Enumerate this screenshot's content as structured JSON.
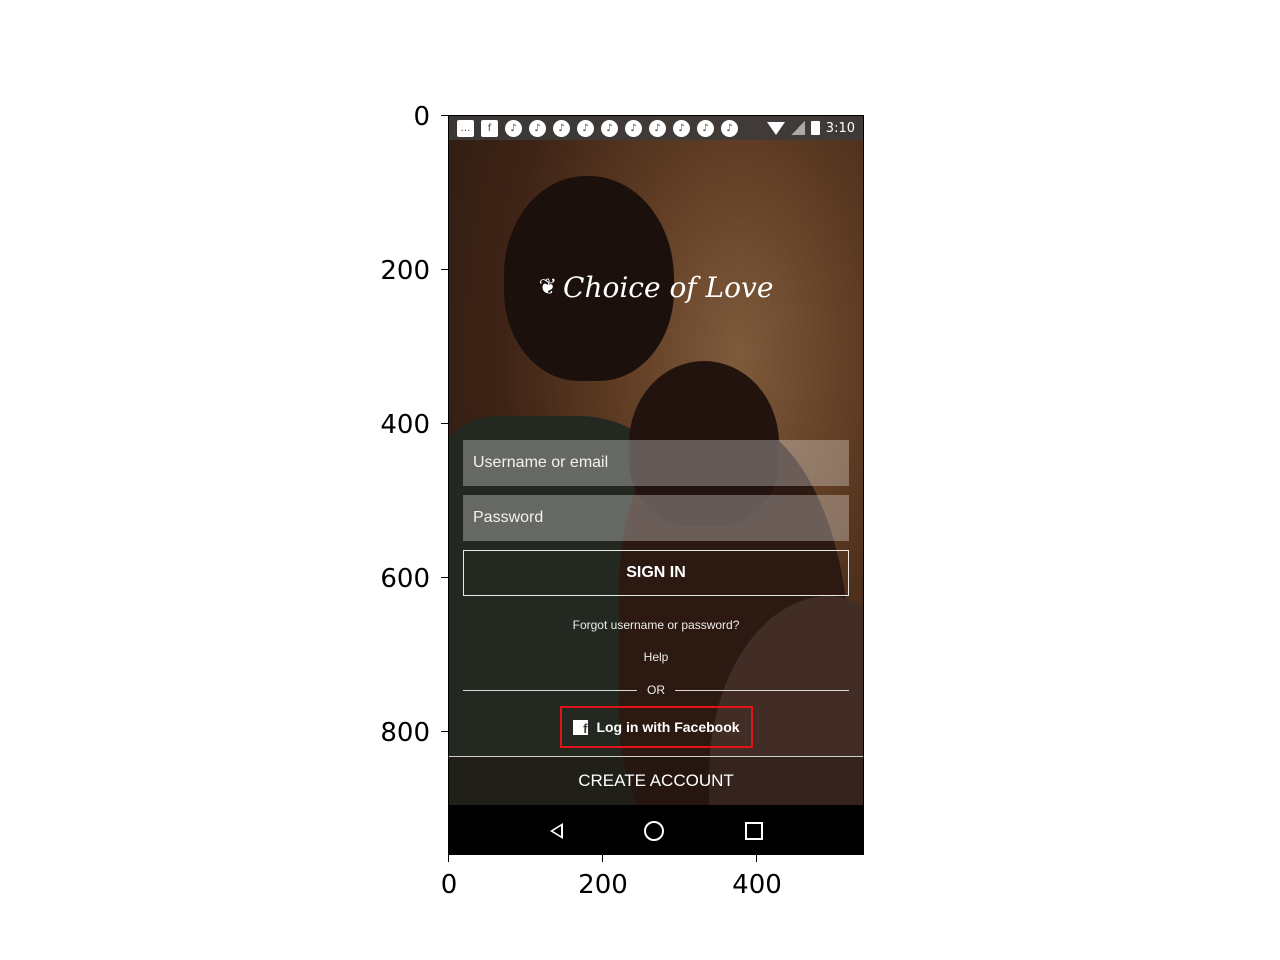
{
  "axes": {
    "y_ticks": [
      "0",
      "200",
      "400",
      "600",
      "800"
    ],
    "x_ticks": [
      "0",
      "200",
      "400"
    ]
  },
  "status_bar": {
    "time": "3:10",
    "notification_icons": [
      "message-icon",
      "facebook-icon",
      "app-notification-icon"
    ]
  },
  "app": {
    "name": "Choice of Love",
    "logo_icon": "couple-logo-icon"
  },
  "login_form": {
    "username_placeholder": "Username or email",
    "password_placeholder": "Password",
    "signin_label": "SIGN IN",
    "forgot_label": "Forgot username or password?",
    "help_label": "Help",
    "or_label": "OR",
    "facebook_label": "Log in with Facebook",
    "create_account_label": "CREATE ACCOUNT"
  },
  "colors": {
    "highlight_border": "#e1141a",
    "background_tone": "#6b4329"
  }
}
